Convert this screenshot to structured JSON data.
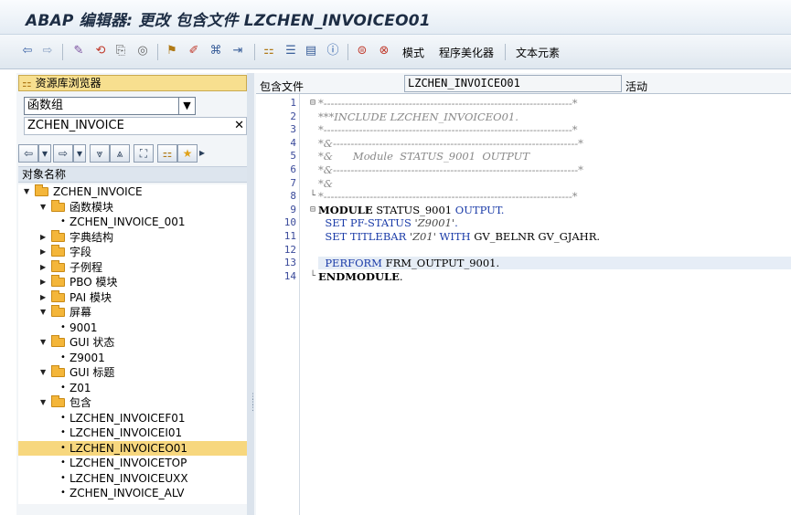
{
  "window": {
    "title": "ABAP 编辑器: 更改 包含文件 LZCHEN_INVOICEO01"
  },
  "toolbar": {
    "mode_label": "模式",
    "pretty_printer_label": "程序美化器",
    "text_elements_label": "文本元素"
  },
  "left": {
    "repo_browser_label": "资源库浏览器",
    "object_type": "函数组",
    "object_name": "ZCHEN_INVOICE",
    "tree_header": "对象名称",
    "tree": [
      {
        "label": "ZCHEN_INVOICE",
        "level": 0,
        "type": "folder",
        "expanded": true
      },
      {
        "label": "函数模块",
        "level": 1,
        "type": "folder",
        "expanded": true
      },
      {
        "label": "ZCHEN_INVOICE_001",
        "level": 2,
        "type": "leaf"
      },
      {
        "label": "字典结构",
        "level": 1,
        "type": "folder",
        "expanded": false
      },
      {
        "label": "字段",
        "level": 1,
        "type": "folder",
        "expanded": false
      },
      {
        "label": "子例程",
        "level": 1,
        "type": "folder",
        "expanded": false
      },
      {
        "label": "PBO 模块",
        "level": 1,
        "type": "folder",
        "expanded": false
      },
      {
        "label": "PAI 模块",
        "level": 1,
        "type": "folder",
        "expanded": false
      },
      {
        "label": "屏幕",
        "level": 1,
        "type": "folder",
        "expanded": true
      },
      {
        "label": "9001",
        "level": 2,
        "type": "leaf"
      },
      {
        "label": "GUI 状态",
        "level": 1,
        "type": "folder",
        "expanded": true
      },
      {
        "label": "Z9001",
        "level": 2,
        "type": "leaf"
      },
      {
        "label": "GUI 标题",
        "level": 1,
        "type": "folder",
        "expanded": true
      },
      {
        "label": "Z01",
        "level": 2,
        "type": "leaf"
      },
      {
        "label": "包含",
        "level": 1,
        "type": "folder",
        "expanded": true
      },
      {
        "label": "LZCHEN_INVOICEF01",
        "level": 2,
        "type": "leaf"
      },
      {
        "label": "LZCHEN_INVOICEI01",
        "level": 2,
        "type": "leaf"
      },
      {
        "label": "LZCHEN_INVOICEO01",
        "level": 2,
        "type": "leaf",
        "selected": true
      },
      {
        "label": "LZCHEN_INVOICETOP",
        "level": 2,
        "type": "leaf"
      },
      {
        "label": "LZCHEN_INVOICEUXX",
        "level": 2,
        "type": "leaf"
      },
      {
        "label": "ZCHEN_INVOICE_ALV",
        "level": 2,
        "type": "leaf"
      }
    ]
  },
  "editor": {
    "include_label": "包含文件",
    "include_name": "LZCHEN_INVOICEO01",
    "status": "活动",
    "lines": [
      {
        "n": "1",
        "fold": "⊟",
        "segs": [
          {
            "c": "cm",
            "t": "*----------------------------------------------------------------------*"
          }
        ]
      },
      {
        "n": "2",
        "fold": "",
        "segs": [
          {
            "c": "cm",
            "t": "***INCLUDE LZCHEN_INVOICEO01."
          }
        ]
      },
      {
        "n": "3",
        "fold": "",
        "segs": [
          {
            "c": "cm",
            "t": "*----------------------------------------------------------------------*"
          }
        ]
      },
      {
        "n": "4",
        "fold": "",
        "segs": [
          {
            "c": "cm",
            "t": "*&---------------------------------------------------------------------*"
          }
        ]
      },
      {
        "n": "5",
        "fold": "",
        "segs": [
          {
            "c": "cm",
            "t": "*&      Module  STATUS_9001  OUTPUT"
          }
        ]
      },
      {
        "n": "6",
        "fold": "",
        "segs": [
          {
            "c": "cm",
            "t": "*&---------------------------------------------------------------------*"
          }
        ]
      },
      {
        "n": "7",
        "fold": "",
        "segs": [
          {
            "c": "cm",
            "t": "*&"
          }
        ]
      },
      {
        "n": "8",
        "fold": "└",
        "segs": [
          {
            "c": "cm",
            "t": "*----------------------------------------------------------------------*"
          }
        ]
      },
      {
        "n": "9",
        "fold": "⊟",
        "segs": [
          {
            "c": "bd",
            "t": "MODULE"
          },
          {
            "c": "",
            "t": " STATUS_9001 "
          },
          {
            "c": "kw",
            "t": "OUTPUT."
          }
        ]
      },
      {
        "n": "10",
        "fold": "",
        "segs": [
          {
            "c": "",
            "t": "  "
          },
          {
            "c": "kw",
            "t": "SET PF-STATUS "
          },
          {
            "c": "str",
            "t": "'Z9001'"
          },
          {
            "c": "kw",
            "t": "."
          }
        ]
      },
      {
        "n": "11",
        "fold": "",
        "segs": [
          {
            "c": "",
            "t": "  "
          },
          {
            "c": "kw",
            "t": "SET TITLEBAR "
          },
          {
            "c": "str",
            "t": "'Z01'"
          },
          {
            "c": "kw",
            "t": " WITH "
          },
          {
            "c": "",
            "t": "GV_BELNR GV_GJAHR."
          }
        ]
      },
      {
        "n": "12",
        "fold": "",
        "segs": []
      },
      {
        "n": "13",
        "fold": "",
        "cur": true,
        "segs": [
          {
            "c": "",
            "t": "  "
          },
          {
            "c": "kw",
            "t": "PERFORM "
          },
          {
            "c": "",
            "t": "FRM_OUTPUT_9001."
          }
        ]
      },
      {
        "n": "14",
        "fold": "└",
        "segs": [
          {
            "c": "bd",
            "t": "ENDMODULE"
          },
          {
            "c": "",
            "t": "."
          }
        ]
      }
    ]
  }
}
